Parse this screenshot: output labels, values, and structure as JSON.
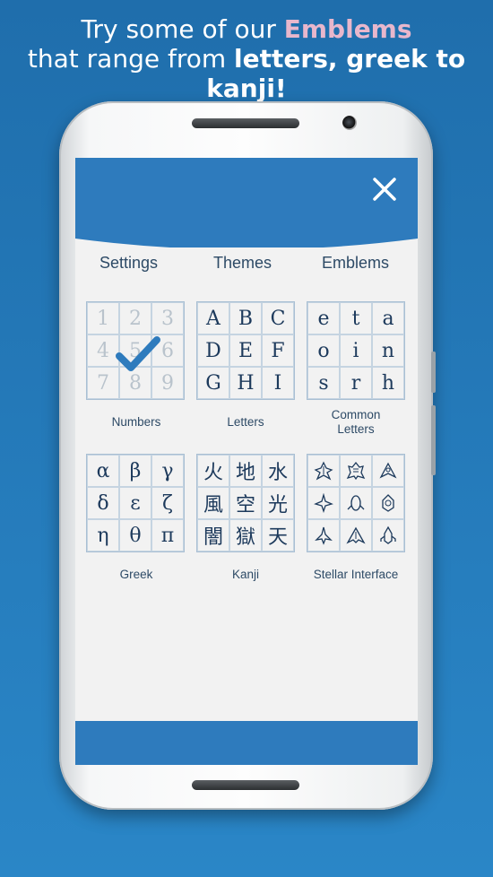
{
  "headline": {
    "line1_pre": "Try some of our ",
    "line1_highlight": "Emblems",
    "line2_pre": "that range from ",
    "line2_bold": "letters, greek to kanji!"
  },
  "tabs": [
    "Settings",
    "Themes",
    "Emblems"
  ],
  "emblem_sets": [
    {
      "caption": "Numbers",
      "cells": [
        "1",
        "2",
        "3",
        "4",
        "5",
        "6",
        "7",
        "8",
        "9"
      ],
      "selected": true
    },
    {
      "caption": "Letters",
      "cells": [
        "A",
        "B",
        "C",
        "D",
        "E",
        "F",
        "G",
        "H",
        "I"
      ]
    },
    {
      "caption_line1": "Common",
      "caption_line2": "Letters",
      "cells": [
        "e",
        "t",
        "a",
        "o",
        "i",
        "n",
        "s",
        "r",
        "h"
      ]
    },
    {
      "caption": "Greek",
      "cells": [
        "α",
        "β",
        "γ",
        "δ",
        "ε",
        "ζ",
        "η",
        "θ",
        "π"
      ]
    },
    {
      "caption": "Kanji",
      "cells": [
        "火",
        "地",
        "水",
        "風",
        "空",
        "光",
        "闇",
        "獄",
        "天"
      ]
    },
    {
      "caption": "Stellar Interface",
      "cells": [
        "ship-1",
        "ship-2",
        "ship-3",
        "ship-4",
        "ship-5",
        "ship-6",
        "ship-7",
        "ship-8",
        "ship-9"
      ]
    }
  ],
  "icons": {
    "close": "close-icon",
    "selected": "checkmark-icon"
  },
  "colors": {
    "accent": "#2e7bbd",
    "highlight": "#e8b7cc",
    "text": "#2d4a66"
  }
}
